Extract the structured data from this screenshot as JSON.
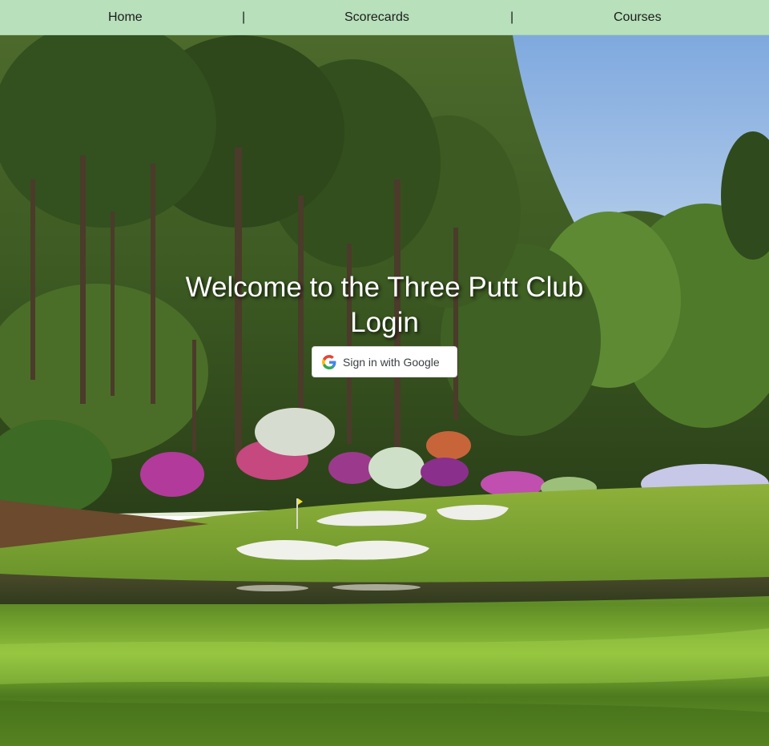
{
  "nav": {
    "home_label": "Home",
    "separator_1": "|",
    "scorecards_label": "Scorecards",
    "separator_2": "|",
    "courses_label": "Courses"
  },
  "hero": {
    "title": "Welcome to the Three Putt Club",
    "login_heading": "Login",
    "google_button_label": "Sign in with Google",
    "google_icon": "google-g-logo"
  },
  "colors": {
    "navbar_bg": "#b7e0bb",
    "sky": "#8fb6e0",
    "fairway": "#6f9a2c",
    "text_white": "#ffffff"
  }
}
